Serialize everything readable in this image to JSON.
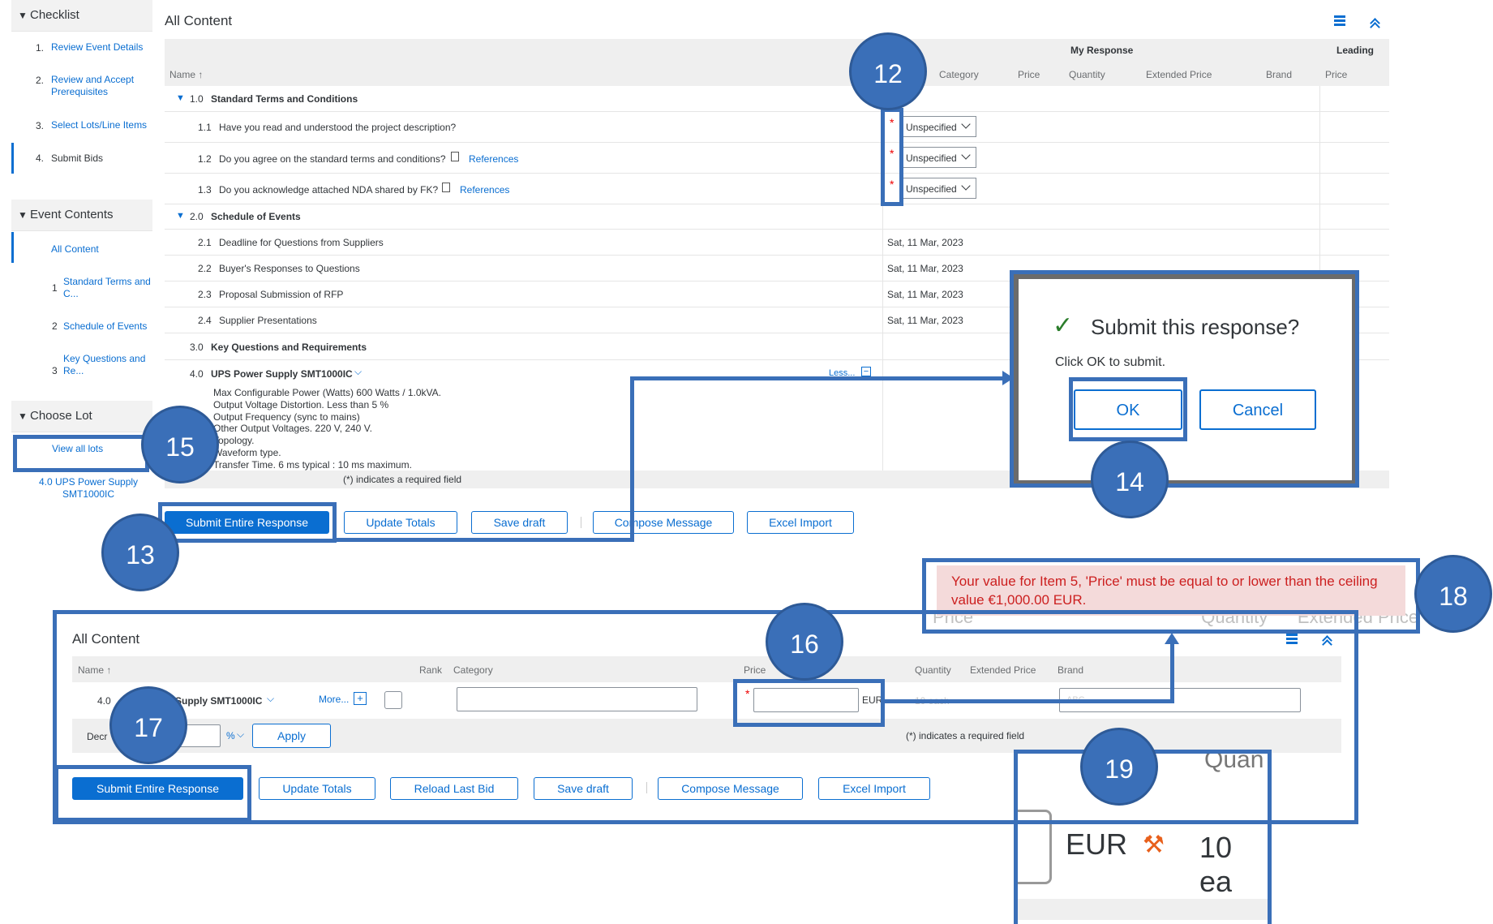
{
  "sidebar": {
    "checklist": {
      "title": "Checklist",
      "items": [
        {
          "num": "1.",
          "label": "Review Event Details"
        },
        {
          "num": "2.",
          "label": "Review and Accept Prerequisites"
        },
        {
          "num": "3.",
          "label": "Select Lots/Line Items"
        },
        {
          "num": "4.",
          "label": "Submit Bids"
        }
      ]
    },
    "event_contents": {
      "title": "Event Contents",
      "all": "All Content",
      "items": [
        {
          "num": "1",
          "label": "Standard Terms and C..."
        },
        {
          "num": "2",
          "label": "Schedule of Events"
        },
        {
          "num": "3",
          "label": "Key Questions and Re..."
        }
      ]
    },
    "choose_lot": {
      "title": "Choose Lot",
      "view_all": "View all lots",
      "lot": "4.0 UPS Power Supply SMT1000IC"
    }
  },
  "main": {
    "title": "All Content",
    "group_my_response": "My Response",
    "group_leading": "Leading",
    "columns": {
      "name": "Name ↑",
      "category": "Category",
      "price": "Price",
      "quantity": "Quantity",
      "extended_price": "Extended Price",
      "brand": "Brand",
      "leading_price": "Price"
    },
    "rows": [
      {
        "num": "1.0",
        "label": "Standard Terms and Conditions"
      },
      {
        "num": "1.1",
        "label": "Have you read and understood the project description?",
        "value": "Unspecified"
      },
      {
        "num": "1.2",
        "label": "Do you agree on the standard terms and conditions?",
        "value": "Unspecified",
        "ref": "References"
      },
      {
        "num": "1.3",
        "label": "Do you acknowledge attached NDA shared by FK?",
        "value": "Unspecified",
        "ref": "References"
      },
      {
        "num": "2.0",
        "label": "Schedule of Events"
      },
      {
        "num": "2.1",
        "label": "Deadline for Questions from Suppliers",
        "date": "Sat, 11 Mar, 2023"
      },
      {
        "num": "2.2",
        "label": "Buyer's Responses to Questions",
        "date": "Sat, 11 Mar, 2023"
      },
      {
        "num": "2.3",
        "label": "Proposal Submission  of RFP",
        "date": "Sat, 11 Mar, 2023"
      },
      {
        "num": "2.4",
        "label": "Supplier Presentations",
        "date": "Sat, 11 Mar, 2023"
      },
      {
        "num": "3.0",
        "label": "Key Questions and Requirements"
      },
      {
        "num": "4.0",
        "label": "UPS Power Supply SMT1000IC",
        "less": "Less..."
      }
    ],
    "description": [
      "Max Configurable Power (Watts) 600 Watts / 1.0kVA.",
      "Output Voltage Distortion. Less than 5 %",
      "Output Frequency (sync to mains)",
      "Other Output Voltages. 220 V, 240 V.",
      "Topology.",
      "Waveform type.",
      "Transfer Time. 6 ms typical : 10 ms maximum."
    ],
    "required_note": "(*) indicates a required field",
    "buttons": {
      "submit": "Submit Entire Response",
      "update": "Update Totals",
      "save": "Save draft",
      "compose": "Compose Message",
      "excel": "Excel Import"
    }
  },
  "dialog": {
    "title": "Submit this response?",
    "message": "Click OK to submit.",
    "ok": "OK",
    "cancel": "Cancel"
  },
  "error": {
    "message": "Your value for Item 5, 'Price' must be equal to or lower than the ceiling value €1,000.00 EUR.",
    "behind_text": "Price                                              Quantity      Extended Price"
  },
  "second": {
    "title": "All Content",
    "columns": {
      "name": "Name ↑",
      "rank": "Rank",
      "category": "Category",
      "price": "Price",
      "quantity": "Quantity",
      "extended_price": "Extended Price",
      "brand": "Brand"
    },
    "row_num": "4.0",
    "row_label": "Supply SMT1000IC",
    "more": "More...",
    "currency": "EUR",
    "qty_faint": "10 each",
    "brand_faint": "ABC",
    "decrease_label": "Decr",
    "percent": "%",
    "apply": "Apply",
    "required_note": "(*) indicates a required field",
    "buttons": {
      "submit": "Submit Entire Response",
      "update": "Update Totals",
      "reload": "Reload Last Bid",
      "save": "Save draft",
      "compose": "Compose Message",
      "excel": "Excel Import"
    }
  },
  "zoom": {
    "top_faint": "Quan",
    "currency": "EUR",
    "qty": "10 ea"
  },
  "callouts": [
    "12",
    "13",
    "14",
    "15",
    "16",
    "17",
    "18",
    "19"
  ],
  "colors": {
    "callout": "#3a6fb8",
    "link": "#0a6ed1",
    "error_bg": "#f4dada",
    "error_text": "#cc1f1f"
  }
}
